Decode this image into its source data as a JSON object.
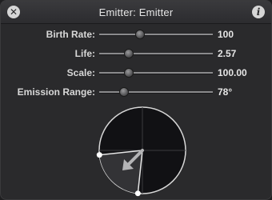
{
  "window": {
    "title": "Emitter: Emitter"
  },
  "properties": [
    {
      "label": "Birth Rate:",
      "value": "100",
      "fraction": 0.36
    },
    {
      "label": "Life:",
      "value": "2.57",
      "fraction": 0.26
    },
    {
      "label": "Scale:",
      "value": "100.00",
      "fraction": 0.26
    },
    {
      "label": "Emission Range:",
      "value": "78°",
      "fraction": 0.22
    }
  ],
  "emission_dial": {
    "emission_range_degrees": 78
  },
  "colors": {
    "panel_background": "#2a2a2c",
    "dial_fill": "#111114",
    "dial_range": "#333336",
    "text": "#d8d8d8"
  }
}
